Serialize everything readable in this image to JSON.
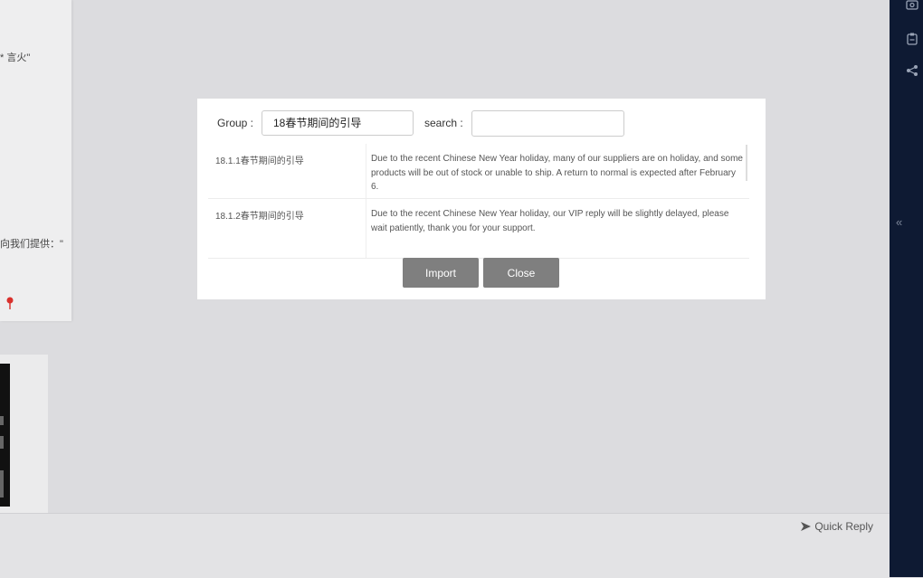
{
  "background": {
    "fragment_top": "* ⾔火\"",
    "fragment_middle": "向我们提供：\"",
    "pin_icon": "map-pin-icon"
  },
  "modal": {
    "group_label": "Group :",
    "group_value": "18春节期间的引导",
    "search_label": "search :",
    "search_value": "",
    "replies": [
      {
        "title": "18.1.1春节期间的引导",
        "content": "Due to the recent Chinese New Year holiday, many of our suppliers are on holiday, and some products will be out of stock or unable to ship. A return to normal is expected after February 6."
      },
      {
        "title": "18.1.2春节期间的引导",
        "content": "Due to the recent Chinese New Year holiday, our VIP reply will be slightly delayed, please wait patiently, thank you for your support."
      }
    ],
    "import_label": "Import",
    "close_label": "Close"
  },
  "bottom_bar": {
    "quick_reply_label": "Quick Reply",
    "quick_reply_icon": "send-arrow-icon"
  },
  "right_bar": {
    "icons": [
      "screenshot-icon",
      "clipboard-icon",
      "share-icon"
    ],
    "collapse_glyph": "«"
  }
}
